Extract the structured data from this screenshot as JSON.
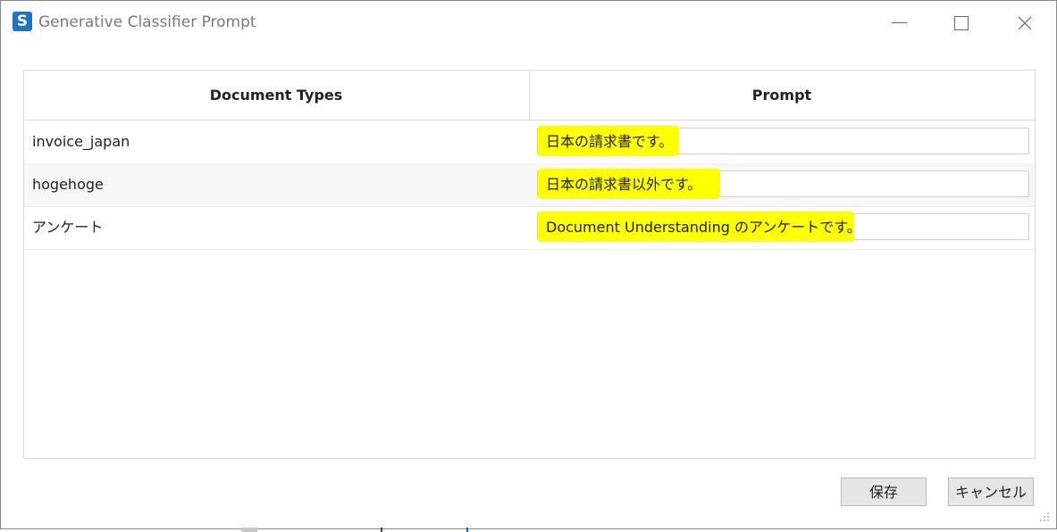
{
  "window": {
    "title": "Generative Classifier Prompt",
    "app_icon": "app-logo-icon",
    "controls": [
      "minimize-icon",
      "maximize-icon",
      "close-icon"
    ]
  },
  "table": {
    "headers": [
      "Document Types",
      "Prompt"
    ],
    "rows": [
      {
        "document_type": "invoice_japan",
        "prompt": "日本の請求書です。"
      },
      {
        "document_type": "hogehoge",
        "prompt": "日本の請求書以外です。"
      },
      {
        "document_type": "アンケート",
        "prompt": "Document Understanding のアンケートです。"
      }
    ]
  },
  "buttons": {
    "save_label": "保存",
    "cancel_label": "キャンセル"
  },
  "colors": {
    "highlight": "#ffff00",
    "accent": "#1f73c6"
  }
}
